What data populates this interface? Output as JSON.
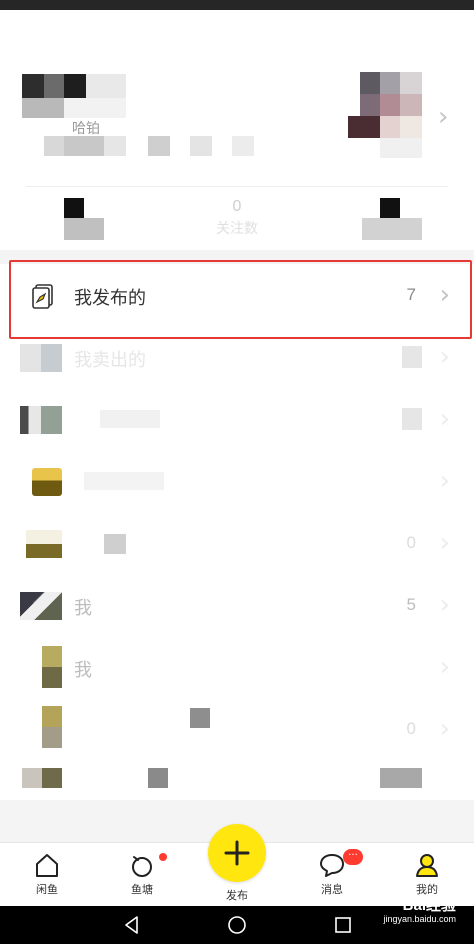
{
  "profile": {
    "name": "哈铂",
    "stats": [
      {
        "num": "0",
        "label": ""
      },
      {
        "num": "0",
        "label": "关注数"
      },
      {
        "num": "",
        "label": ""
      }
    ]
  },
  "menu": [
    {
      "label": "我发布的",
      "count": "7",
      "icon": "published-document-icon",
      "faded": false
    },
    {
      "label": "我卖出的",
      "count": "",
      "icon": "sold-icon",
      "faded": true
    },
    {
      "label": "",
      "count": "",
      "icon": "bought-icon",
      "faded": true
    },
    {
      "label": "",
      "count": "",
      "icon": "coupon-icon",
      "faded": true
    },
    {
      "label": "",
      "count": "0",
      "icon": "star-icon",
      "faded": true
    },
    {
      "label": "我",
      "count": "5",
      "icon": "history-icon",
      "faded": true
    },
    {
      "label": "我",
      "count": "",
      "icon": "bookmark-icon",
      "faded": true
    },
    {
      "label": "",
      "count": "0",
      "icon": "list-icon",
      "faded": true
    }
  ],
  "tabs": [
    {
      "label": "闲鱼",
      "icon": "home-icon"
    },
    {
      "label": "鱼塘",
      "icon": "pond-icon"
    },
    {
      "label": "发布",
      "icon": "plus-icon"
    },
    {
      "label": "消息",
      "icon": "message-icon",
      "badge": "···"
    },
    {
      "label": "我的",
      "icon": "profile-icon"
    }
  ],
  "watermark": {
    "brand": "Bai经验",
    "url": "jingyan.baidu.com"
  },
  "colors": {
    "accent": "#ffe60f",
    "highlight": "#e53935",
    "badge": "#ff3b30"
  }
}
